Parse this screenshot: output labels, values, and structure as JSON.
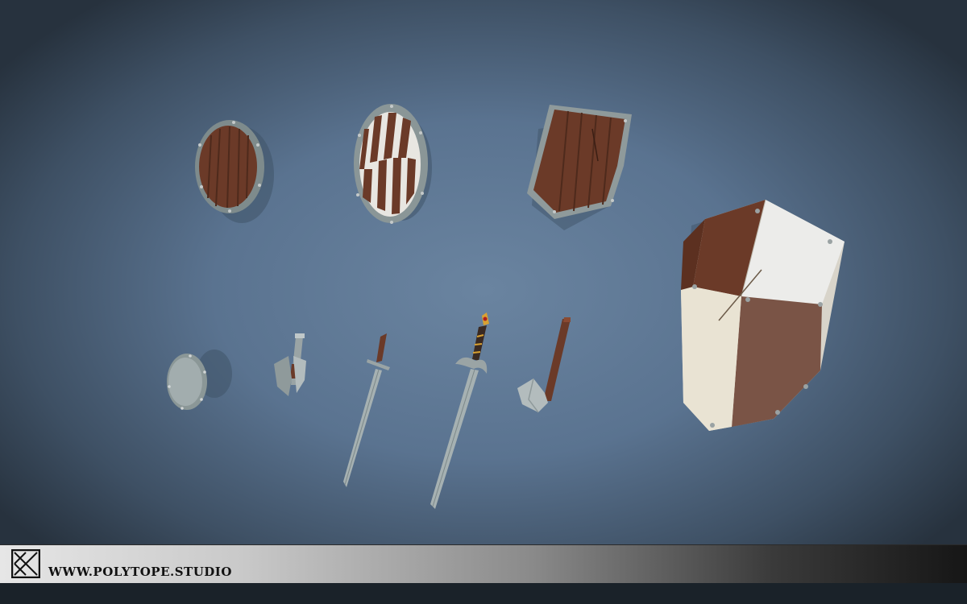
{
  "footer": {
    "url_text": "WWW.POLYTOPE.STUDIO",
    "logo": "polytope-logo-icon"
  },
  "items": [
    {
      "name": "round-wooden-shield",
      "kind": "shield"
    },
    {
      "name": "striped-round-shield",
      "kind": "shield"
    },
    {
      "name": "heater-wooden-shield",
      "kind": "shield"
    },
    {
      "name": "large-kite-shield",
      "kind": "shield"
    },
    {
      "name": "small-buckler",
      "kind": "shield"
    },
    {
      "name": "double-axe",
      "kind": "weapon"
    },
    {
      "name": "plain-sword",
      "kind": "weapon"
    },
    {
      "name": "ornate-sword",
      "kind": "weapon"
    },
    {
      "name": "hand-axe",
      "kind": "weapon"
    }
  ],
  "colors": {
    "background": "#5a7390",
    "wood": "#6b3a28",
    "metal": "#8f9a9b",
    "cream": "#e6e0d4"
  }
}
